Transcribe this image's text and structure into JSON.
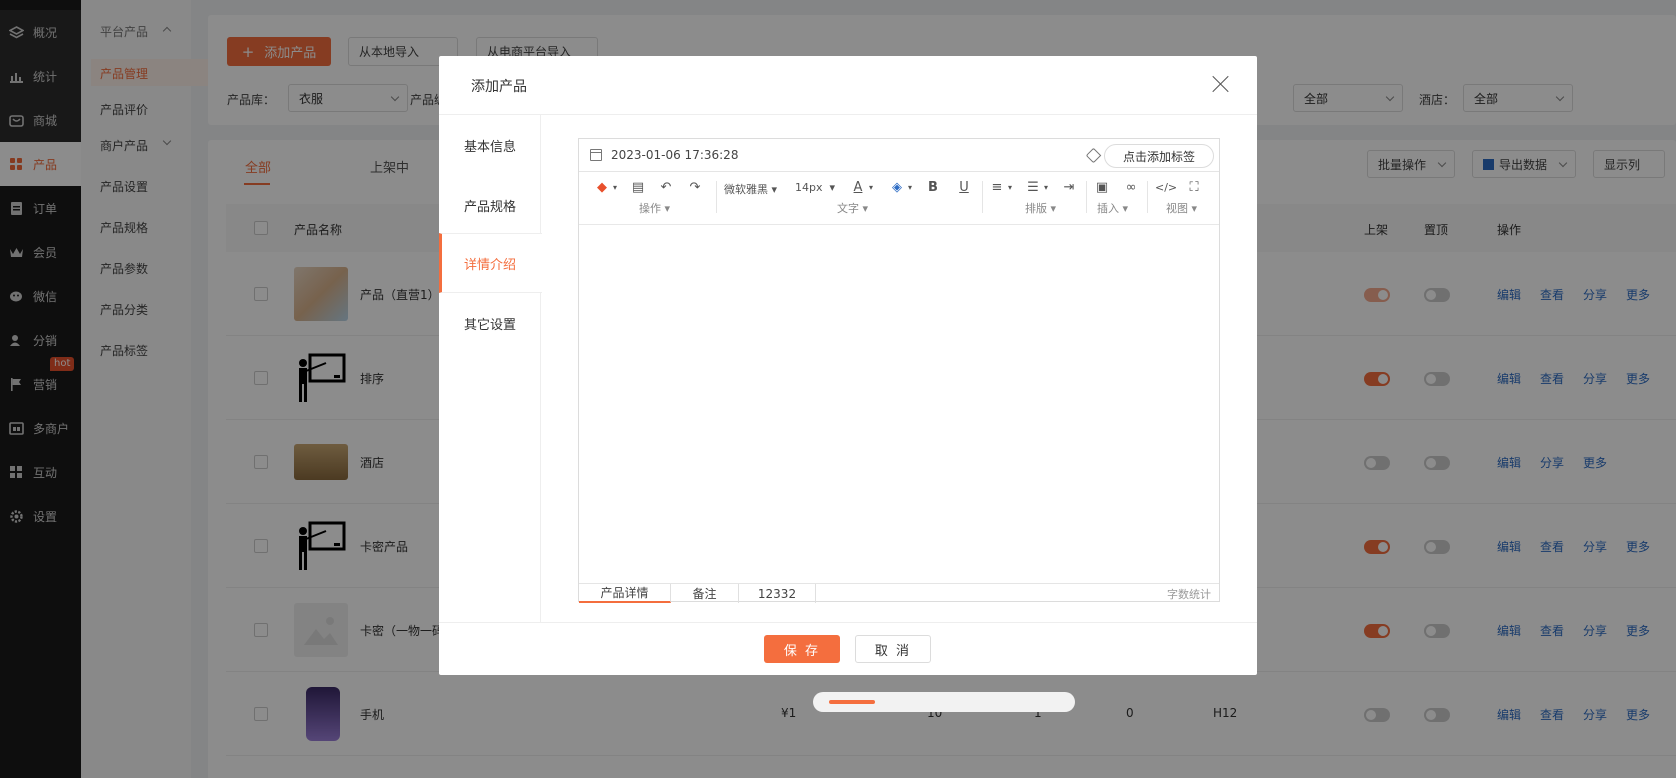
{
  "nav": {
    "items": [
      {
        "label": "概况",
        "icon": "layers-icon"
      },
      {
        "label": "统计",
        "icon": "chart-icon"
      },
      {
        "label": "商城",
        "icon": "shop-icon"
      },
      {
        "label": "产品",
        "icon": "grid-icon",
        "active": true
      },
      {
        "label": "订单",
        "icon": "order-icon"
      },
      {
        "label": "会员",
        "icon": "crown-icon"
      },
      {
        "label": "微信",
        "icon": "wechat-icon"
      },
      {
        "label": "分销",
        "icon": "users-icon"
      },
      {
        "label": "营销",
        "icon": "flag-icon",
        "badge": "hot"
      },
      {
        "label": "多商户",
        "icon": "store-icon"
      },
      {
        "label": "互动",
        "icon": "apps-icon"
      },
      {
        "label": "设置",
        "icon": "gear-icon"
      }
    ]
  },
  "subnav": {
    "group1": "平台产品",
    "items1": [
      "产品管理",
      "产品评价"
    ],
    "group2": "商户产品",
    "items2": [
      "产品设置",
      "产品规格",
      "产品参数",
      "产品分类",
      "产品标签"
    ]
  },
  "toolbar": {
    "add_label": "添加产品",
    "import_local": "从本地导入",
    "import_ecom": "从电商平台导入"
  },
  "filters": {
    "lib_label": "产品库：",
    "lib_value": "衣服",
    "lib2_label": "产品编",
    "all1": "全部",
    "hotel_label": "酒店：",
    "hotel_value": "全部"
  },
  "list_tabs": [
    "全部",
    "上架中"
  ],
  "list_actions": {
    "batch": "批量操作",
    "export": "导出数据",
    "columns": "显示列"
  },
  "table": {
    "headers": {
      "name": "产品名称",
      "shelf": "上架",
      "top": "置顶",
      "ops": "操作"
    },
    "rows": [
      {
        "name": "产品（直营1）",
        "shelf": "on-light",
        "top": "off",
        "ops": [
          "编辑",
          "查看",
          "分享",
          "更多"
        ]
      },
      {
        "name": "排序",
        "shelf": "on",
        "top": "off",
        "ops": [
          "编辑",
          "查看",
          "分享",
          "更多"
        ]
      },
      {
        "name": "酒店",
        "shelf": "off",
        "top": "off",
        "ops": [
          "编辑",
          "分享",
          "更多"
        ]
      },
      {
        "name": "卡密产品",
        "shelf": "on",
        "top": "off",
        "ops": [
          "编辑",
          "查看",
          "分享",
          "更多"
        ]
      },
      {
        "name": "卡密（一物一码",
        "shelf": "on",
        "top": "off",
        "ops": [
          "编辑",
          "查看",
          "分享",
          "更多"
        ]
      },
      {
        "name": "手机",
        "price": "¥1",
        "c1": "10",
        "c2": "1",
        "c3": "0",
        "c4": "H12",
        "shelf": "off",
        "top": "off",
        "ops": [
          "编辑",
          "查看",
          "分享",
          "更多"
        ]
      }
    ]
  },
  "modal": {
    "title": "添加产品",
    "tabs": [
      "基本信息",
      "产品规格",
      "详情介绍",
      "其它设置"
    ],
    "active_tab": 2,
    "datetime": "2023-01-06 17:36:28",
    "add_tag": "点击添加标签",
    "editor": {
      "font": "微软雅黑",
      "size": "14px",
      "groups": [
        "操作",
        "文字",
        "排版",
        "插入",
        "视图"
      ],
      "foot_tabs": [
        "产品详情",
        "备注",
        "12332"
      ],
      "word_count": "字数统计"
    },
    "save": "保 存",
    "cancel": "取 消"
  },
  "colors": {
    "accent": "#f46e3e",
    "sidebar": "#1b1b1b",
    "link": "#2d6cc4"
  }
}
